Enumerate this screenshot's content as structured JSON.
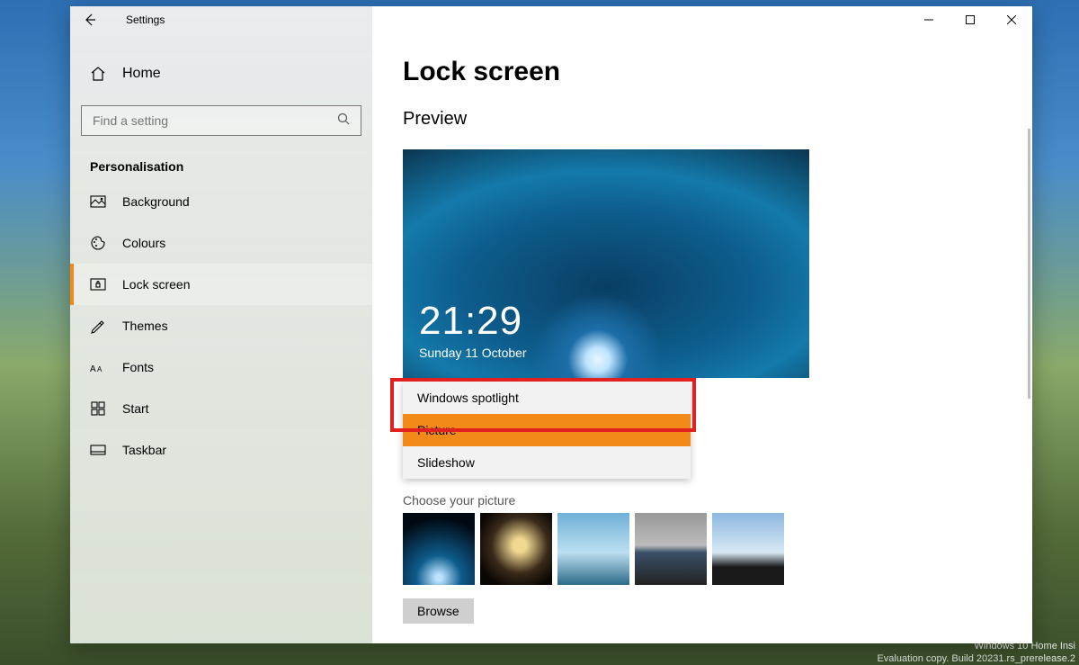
{
  "window": {
    "title": "Settings"
  },
  "sidebar": {
    "home": "Home",
    "search_placeholder": "Find a setting",
    "category": "Personalisation",
    "items": [
      {
        "label": "Background"
      },
      {
        "label": "Colours"
      },
      {
        "label": "Lock screen"
      },
      {
        "label": "Themes"
      },
      {
        "label": "Fonts"
      },
      {
        "label": "Start"
      },
      {
        "label": "Taskbar"
      }
    ]
  },
  "page": {
    "title": "Lock screen",
    "preview_label": "Preview",
    "clock_time": "21:29",
    "clock_date": "Sunday 11 October",
    "choose_picture_label": "Choose your picture",
    "browse": "Browse"
  },
  "dropdown": {
    "options": [
      {
        "label": "Windows spotlight"
      },
      {
        "label": "Picture"
      },
      {
        "label": "Slideshow"
      }
    ],
    "highlighted_index": 0,
    "hovered_index": 1
  },
  "watermark": {
    "line1": "Windows 10 Home Insi",
    "line2": "Evaluation copy. Build 20231.rs_prerelease.2"
  }
}
